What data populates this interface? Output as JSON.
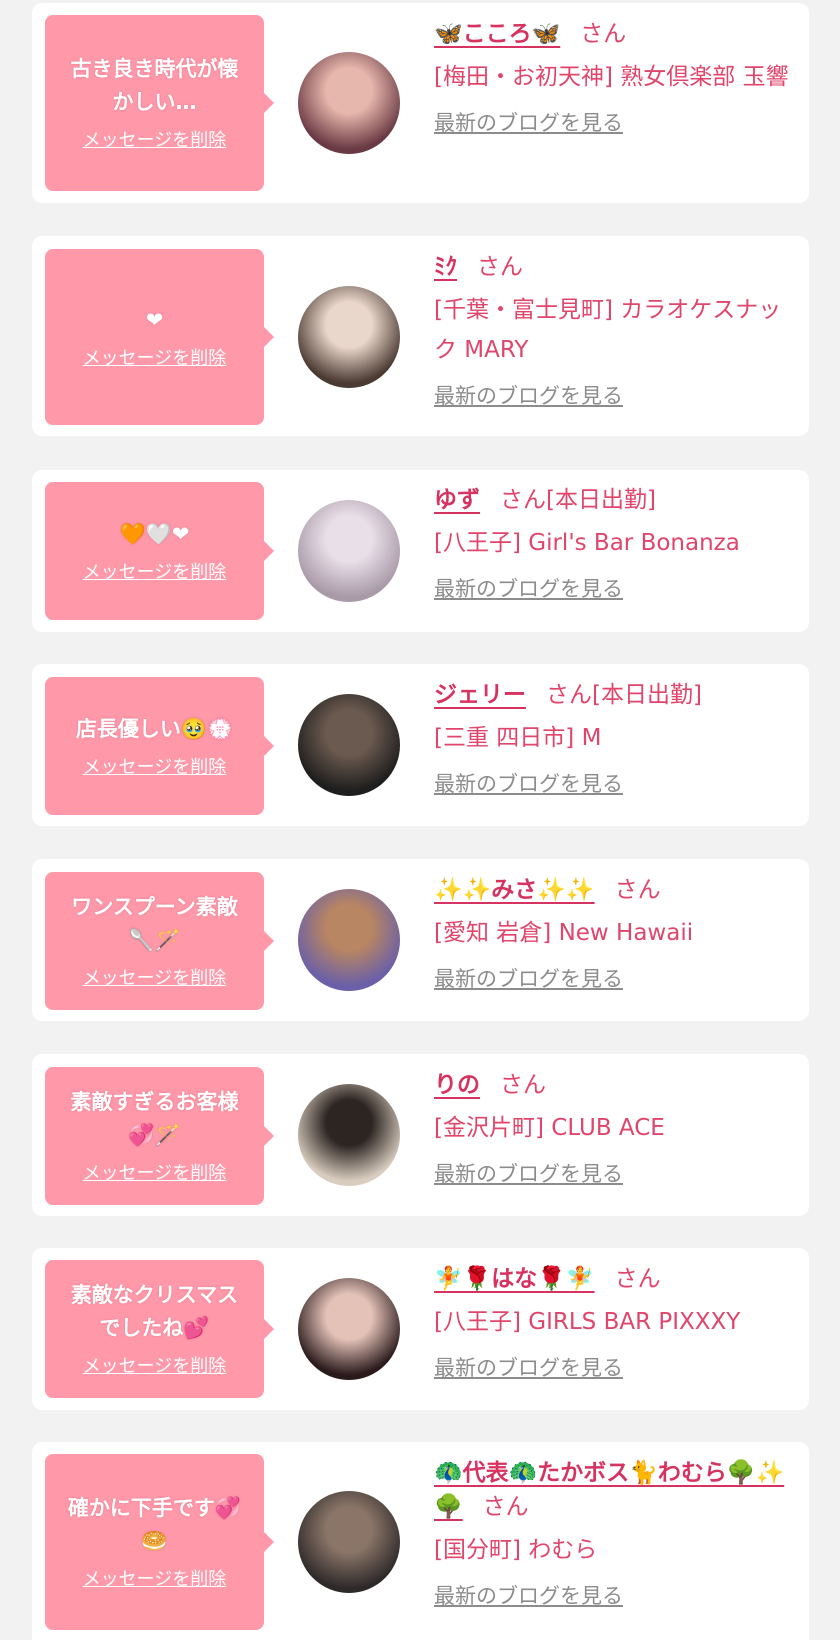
{
  "common": {
    "delete_label": "メッセージを削除",
    "blog_label": "最新のブログを見る",
    "honorific": "さん"
  },
  "colors": {
    "background": "#f2f2f2",
    "card": "#ffffff",
    "bubble": "#ff99aa",
    "name": "#d63360",
    "shop": "#e0456b",
    "link_gray": "#8c8c8c"
  },
  "entries": [
    {
      "message": "古き良き時代が懐\nかしい…",
      "name": "🦋こころ🦋",
      "status": "",
      "shop": "[梅田・お初天神] 熟女倶楽部 玉響",
      "avatar_colors": [
        "#6a3a44",
        "#e6b7ac"
      ]
    },
    {
      "message": "❤",
      "name": "ﾐｸ",
      "status": "",
      "shop": "[千葉・富士見町] カラオケスナック MARY",
      "avatar_colors": [
        "#4a3a32",
        "#ead7cb"
      ]
    },
    {
      "message": "🧡🤍❤",
      "name": "ゆず",
      "status": "[本日出勤]",
      "shop": "[八王子] Girl's Bar Bonanza",
      "avatar_colors": [
        "#a99aa8",
        "#e9dfe8"
      ]
    },
    {
      "message": "店長優しい🥹💮",
      "name": "ジェリー",
      "status": "[本日出勤]",
      "shop": "[三重 四日市] M",
      "avatar_colors": [
        "#1e1e1e",
        "#6b5a4f"
      ]
    },
    {
      "message": "ワンスプーン素敵\n🥄🪄",
      "name": "✨✨みさ✨✨",
      "status": "",
      "shop": "[愛知 岩倉] New Hawaii",
      "avatar_colors": [
        "#6a5fa8",
        "#b88662"
      ]
    },
    {
      "message": "素敵すぎるお客様\n💞🪄",
      "name": "りの",
      "status": "",
      "shop": "[金沢片町] CLUB ACE",
      "avatar_colors": [
        "#d9cdbf",
        "#2d2522"
      ]
    },
    {
      "message": "素敵なクリスマス\nでしたね💕",
      "name": "🧚🌹はな🌹🧚",
      "status": "",
      "shop": "[八王子] GIRLS BAR PIXXXY",
      "avatar_colors": [
        "#2a1a1c",
        "#e4c2b8"
      ]
    },
    {
      "message": "確かに下手です💞\n🥯",
      "name": "🦚代表🦚たかボス🐈わむら🌳✨🌳",
      "status": "",
      "shop": "[国分町] わむら",
      "avatar_colors": [
        "#2f2a2a",
        "#8a7568"
      ]
    }
  ]
}
